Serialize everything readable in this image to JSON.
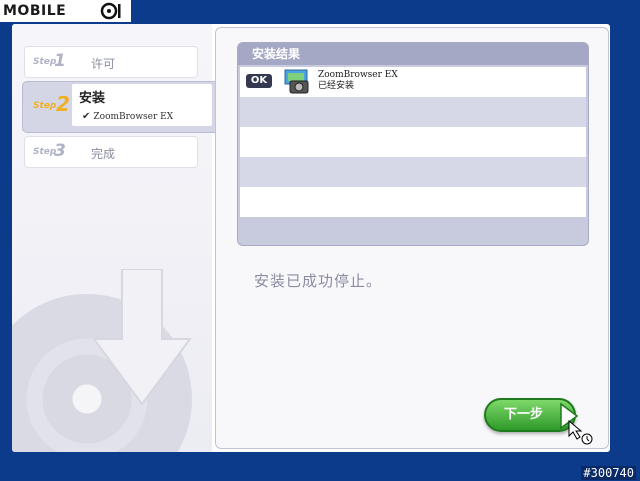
{
  "watermark": "MOBILE",
  "photo_id": "#300740",
  "steps": [
    {
      "word": "Step",
      "num": "1",
      "label": "许可"
    },
    {
      "word": "Step",
      "num": "2",
      "label": "安装",
      "sub": "ZoomBrowser EX"
    },
    {
      "word": "Step",
      "num": "3",
      "label": "完成"
    }
  ],
  "results": {
    "title": "安装结果",
    "items": [
      {
        "badge": "OK",
        "name": "ZoomBrowser EX",
        "status": "已经安装"
      }
    ]
  },
  "status_message": "安装已成功停止。",
  "next_button": "下一步",
  "colors": {
    "background": "#0d3b8c",
    "accent_green": "#2e9a2a",
    "step_active": "#f0b020"
  }
}
